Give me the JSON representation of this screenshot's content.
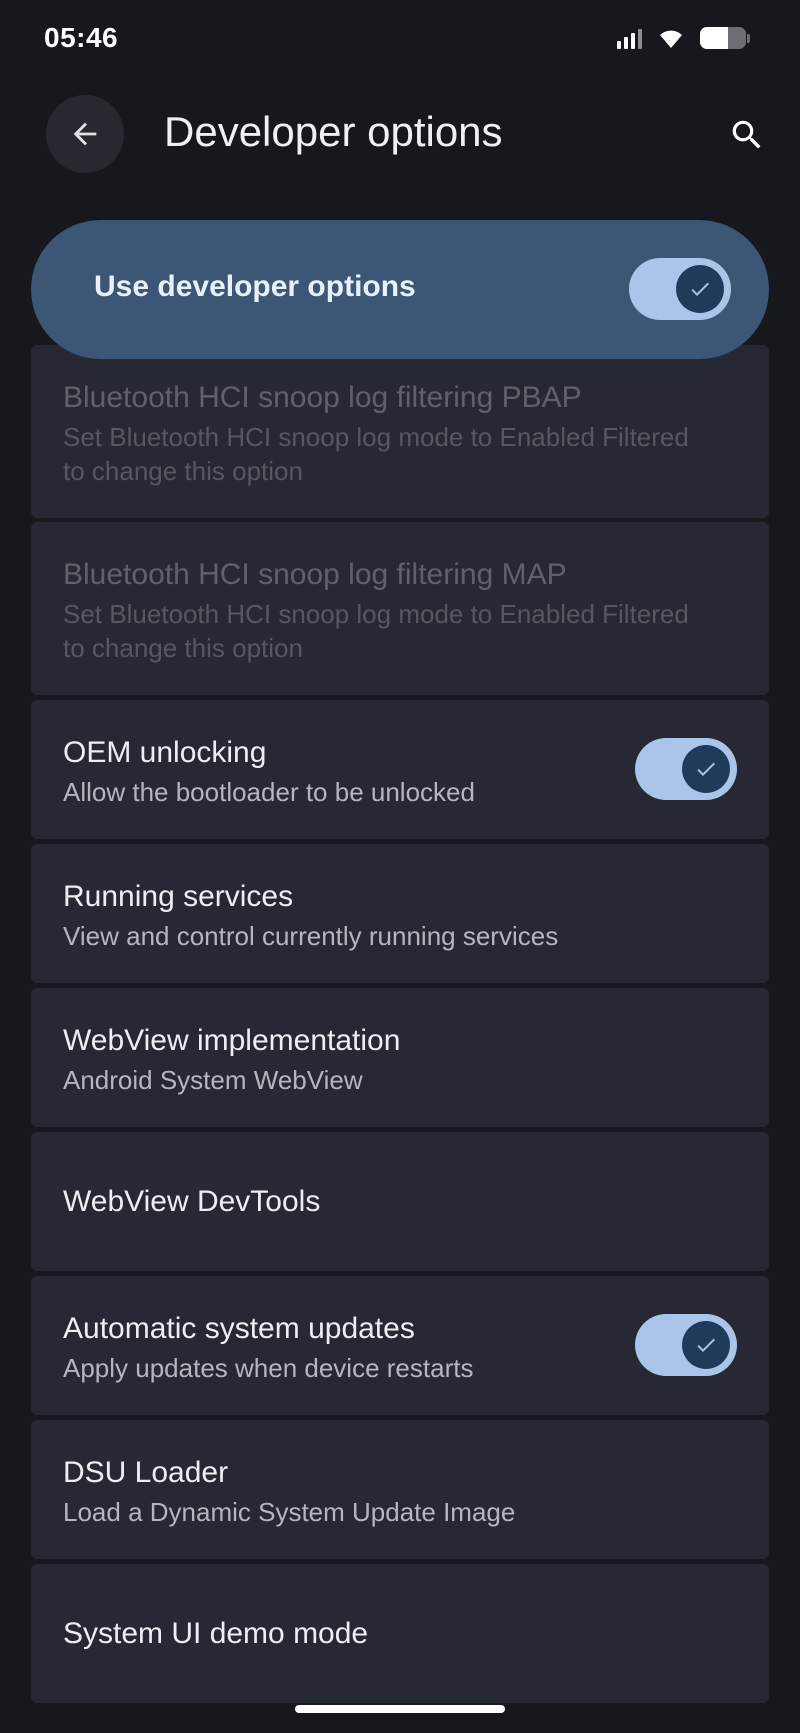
{
  "status_bar": {
    "time": "05:46",
    "battery_level": 0.6
  },
  "header": {
    "title": "Developer options",
    "back_icon": "arrow-left-icon",
    "search_icon": "search-icon"
  },
  "master_toggle": {
    "label": "Use developer options",
    "checked": true
  },
  "items": [
    {
      "title": "Bluetooth HCI snoop log filtering PBAP",
      "subtitle": "Set Bluetooth HCI snoop log mode to Enabled Filtered to change this option",
      "enabled": false
    },
    {
      "title": "Bluetooth HCI snoop log filtering MAP",
      "subtitle": "Set Bluetooth HCI snoop log mode to Enabled Filtered to change this option",
      "enabled": false
    },
    {
      "title": "OEM unlocking",
      "subtitle": "Allow the bootloader to be unlocked",
      "toggle": true
    },
    {
      "title": "Running services",
      "subtitle": "View and control currently running services"
    },
    {
      "title": "WebView implementation",
      "subtitle": "Android System WebView"
    },
    {
      "title": "WebView DevTools"
    },
    {
      "title": "Automatic system updates",
      "subtitle": "Apply updates when device restarts",
      "toggle": true
    },
    {
      "title": "DSU Loader",
      "subtitle": "Load a Dynamic System Update Image"
    },
    {
      "title": "System UI demo mode"
    }
  ],
  "colors": {
    "background": "#16181d",
    "card": "#262933",
    "master_card": "#3c5676",
    "switch_track": "#a9c5ea",
    "switch_knob": "#1f3b5c"
  }
}
